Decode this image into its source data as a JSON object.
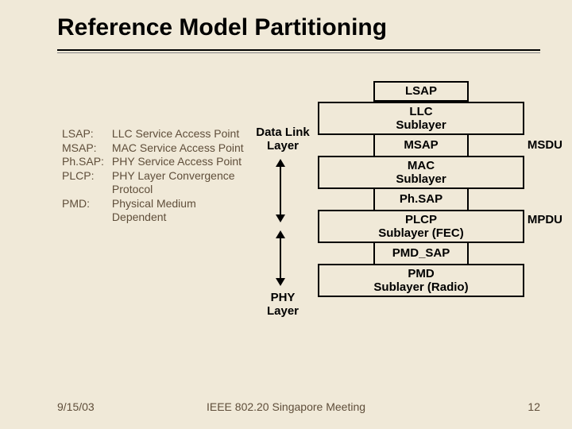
{
  "title": "Reference Model Partitioning",
  "legend": [
    {
      "term": "LSAP:",
      "def": "LLC Service Access Point"
    },
    {
      "term": "MSAP:",
      "def": "MAC Service Access Point"
    },
    {
      "term": "Ph.SAP:",
      "def": "PHY Service Access Point"
    },
    {
      "term": "PLCP:",
      "def": "PHY Layer Convergence Protocol"
    },
    {
      "term": "PMD:",
      "def": "Physical Medium Dependent"
    }
  ],
  "stack": {
    "lsap": "LSAP",
    "llc": "LLC\nSublayer",
    "msap": "MSAP",
    "mac": "MAC\nSublayer",
    "phsap": "Ph.SAP",
    "plcp": "PLCP\nSublayer (FEC)",
    "pmdsap": "PMD_SAP",
    "pmd": "PMD\nSublayer (Radio)"
  },
  "side_labels": {
    "msdu": "MSDU",
    "mpdu": "MPDU"
  },
  "layer_labels": {
    "data_link": "Data Link\nLayer",
    "phy": "PHY\nLayer"
  },
  "footer": {
    "date": "9/15/03",
    "center": "IEEE 802.20 Singapore Meeting",
    "page": "12"
  }
}
